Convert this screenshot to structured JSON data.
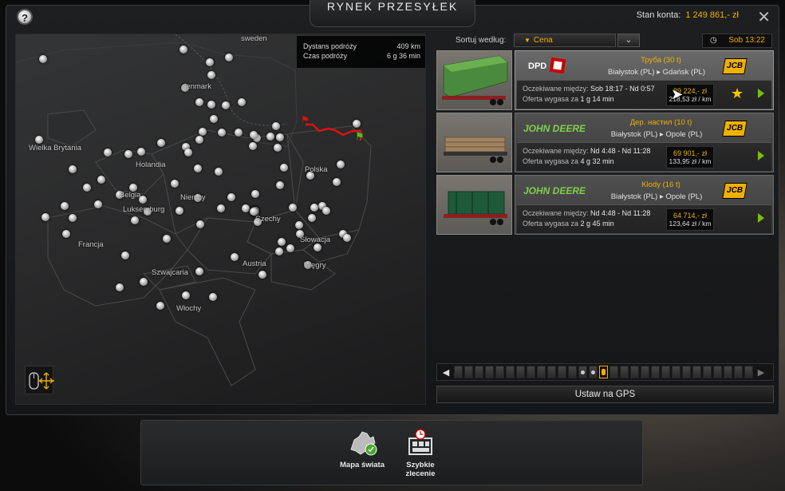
{
  "header": {
    "title": "RYNEK PRZESYŁEK",
    "balance_label": "Stan konta:",
    "balance_value": "1 249 861,- zł",
    "help_icon": "question-icon",
    "close_icon": "close-icon"
  },
  "map": {
    "trip_info": {
      "distance_label": "Dystans podróży",
      "distance_value": "409 km",
      "time_label": "Czas podróży",
      "time_value": "6 g 36 min"
    },
    "labels": {
      "sweden": "sweden",
      "denmark": "denmark",
      "uk": "Wielka Brytania",
      "netherlands": "Holandia",
      "belgium": "Belgia",
      "luxembourg": "Luksemburg",
      "germany": "Niemcy",
      "poland": "Polska",
      "czech": "Czechy",
      "slovakia": "Słowacja",
      "france": "Francja",
      "switzerland": "Szwajcaria",
      "austria": "Austria",
      "hungary": "Węgry",
      "italy": "Włochy"
    }
  },
  "sort": {
    "label": "Sortuj według:",
    "value": "Cena"
  },
  "clock": {
    "time": "Sob 13:22"
  },
  "jobs": [
    {
      "company": "DPD",
      "cargo": "Труба (30 t)",
      "from": "Białystok (PL)",
      "to": "Gdańsk (PL)",
      "window_label": "Oczekiwane między:",
      "window_value": "Sob 18:17 - Nd 0:57",
      "expires_label": "Oferta wygasa za",
      "expires_value": "1 g 14 min",
      "price": "89 224,- zł",
      "per_km": "218,53 zł / km",
      "brand": "JCB",
      "favorite": true,
      "selected": true
    },
    {
      "company": "JOHN DEERE",
      "cargo": "Дер. настил (10 t)",
      "from": "Białystok (PL)",
      "to": "Opole (PL)",
      "window_label": "Oczekiwane między:",
      "window_value": "Nd 4:48 - Nd 11:28",
      "expires_label": "Oferta wygasa za",
      "expires_value": "4 g 32 min",
      "price": "69 901,- zł",
      "per_km": "133,95 zł / km",
      "brand": "JCB",
      "favorite": false,
      "selected": false
    },
    {
      "company": "JOHN DEERE",
      "cargo": "Kłody (16 t)",
      "from": "Białystok (PL)",
      "to": "Opole (PL)",
      "window_label": "Oczekiwane między:",
      "window_value": "Nd 4:48 - Nd 11:28",
      "expires_label": "Oferta wygasa za",
      "expires_value": "2 g 45 min",
      "price": "64 714,- zł",
      "per_km": "123,64 zł / km",
      "brand": "JCB",
      "favorite": false,
      "selected": false
    }
  ],
  "gps_button": "Ustaw na GPS",
  "bottom_menu": {
    "world_map": "Mapa świata",
    "quick_job_line1": "Szybkie",
    "quick_job_line2": "zlecenie"
  },
  "colors": {
    "accent": "#f0b000",
    "go": "#78c000",
    "route": "#e01010"
  }
}
